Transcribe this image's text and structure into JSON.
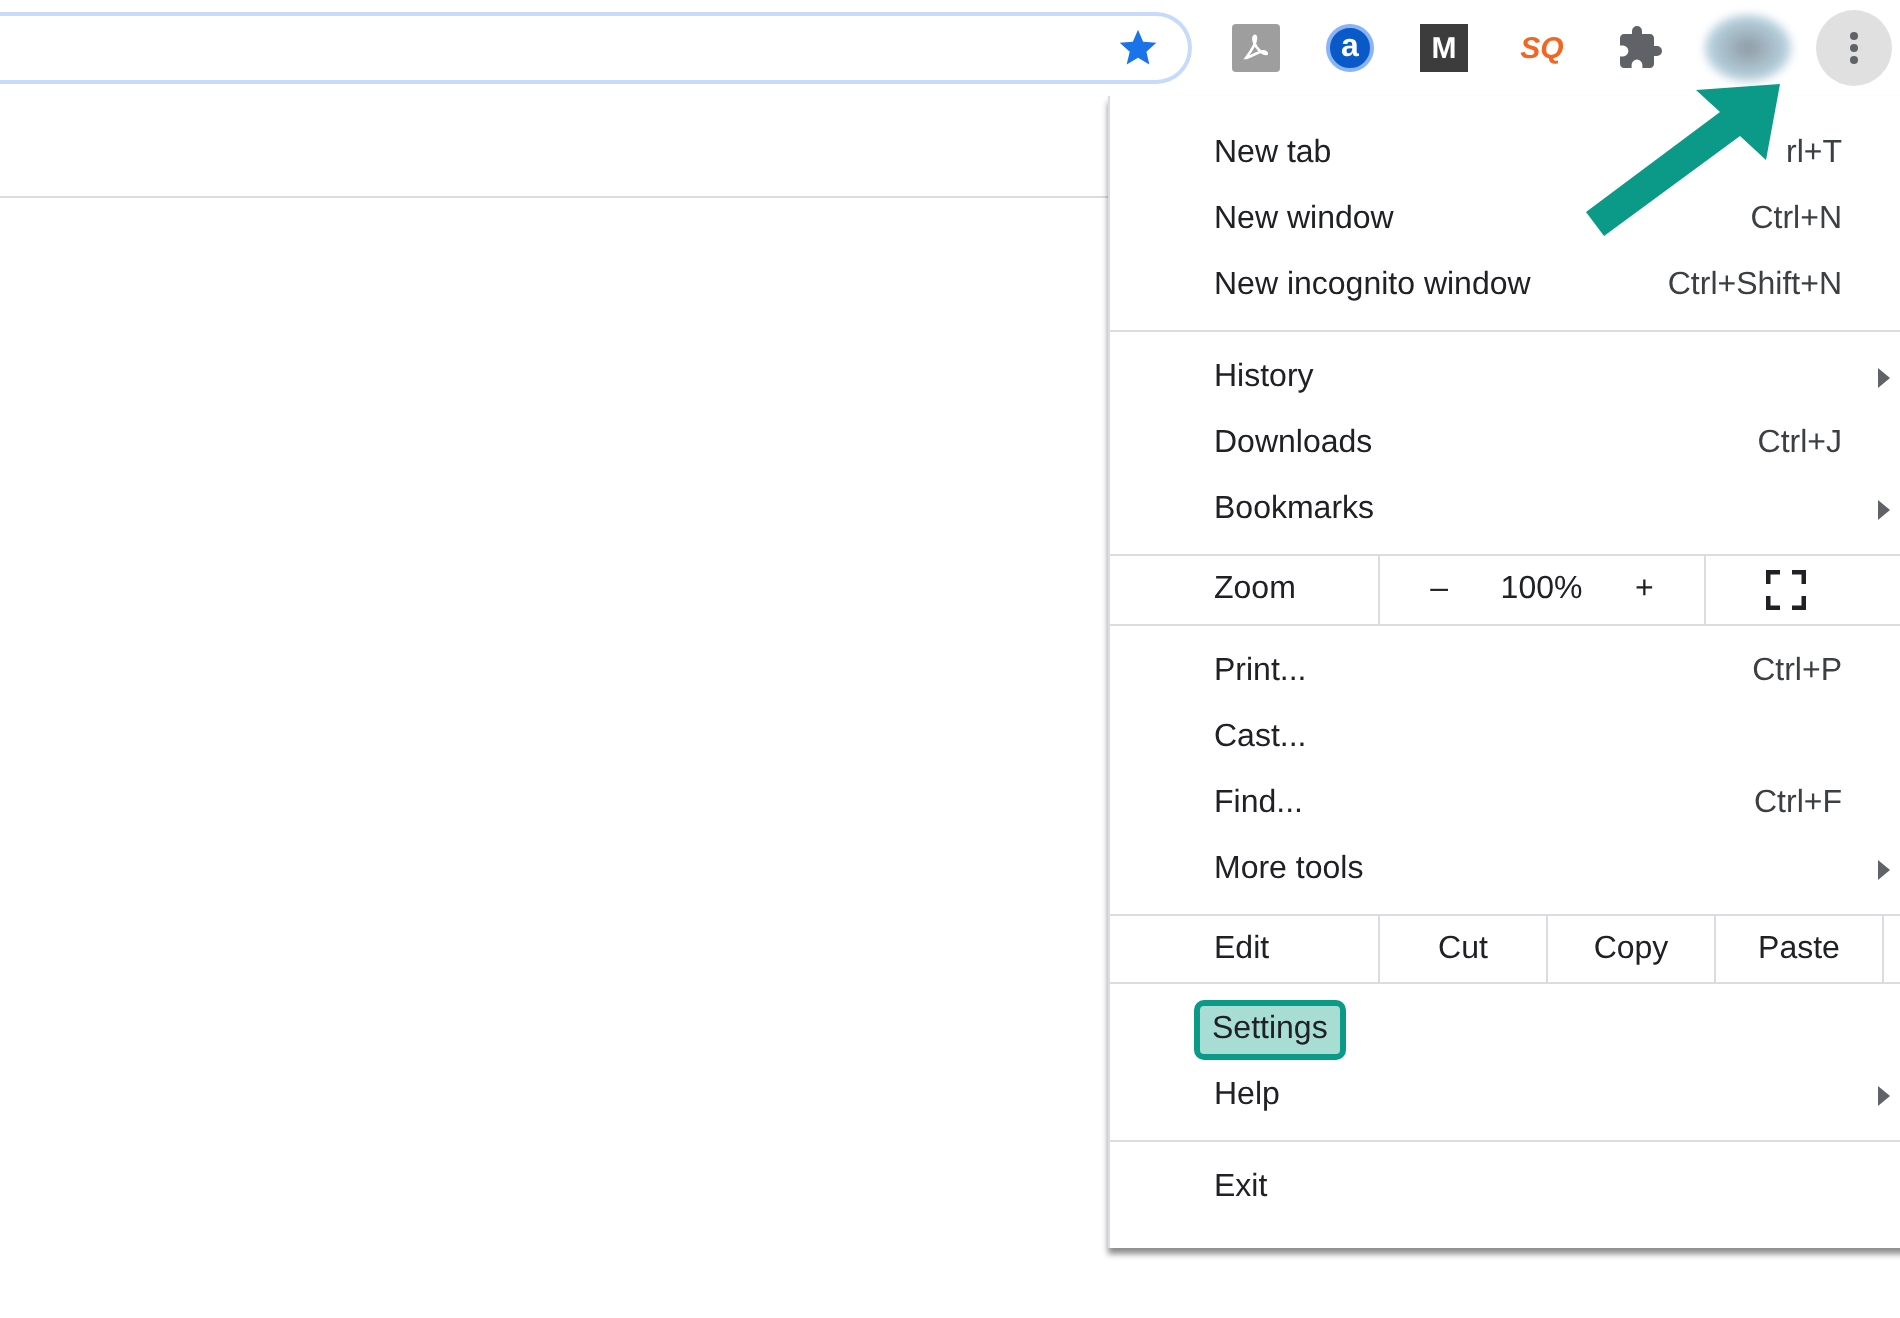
{
  "toolbar": {
    "extensions": [
      {
        "kind": "pdf"
      },
      {
        "kind": "circle",
        "glyph": "a"
      },
      {
        "kind": "square",
        "glyph": "M"
      },
      {
        "kind": "sq",
        "glyph": "SQ"
      },
      {
        "kind": "puzzle"
      }
    ]
  },
  "menu": {
    "sections": [
      [
        {
          "kind": "item",
          "label": "New tab",
          "shortcut": "rl+T",
          "has_submenu": false,
          "highlighted": false
        },
        {
          "kind": "item",
          "label": "New window",
          "shortcut": "Ctrl+N",
          "has_submenu": false,
          "highlighted": false
        },
        {
          "kind": "item",
          "label": "New incognito window",
          "shortcut": "Ctrl+Shift+N",
          "has_submenu": false,
          "highlighted": false
        }
      ],
      [
        {
          "kind": "item",
          "label": "History",
          "has_submenu": true,
          "highlighted": false
        },
        {
          "kind": "item",
          "label": "Downloads",
          "shortcut": "Ctrl+J",
          "has_submenu": false,
          "highlighted": false
        },
        {
          "kind": "item",
          "label": "Bookmarks",
          "has_submenu": true,
          "highlighted": false
        }
      ],
      [
        {
          "kind": "zoom",
          "label": "Zoom",
          "minus": "–",
          "value": "100%",
          "plus": "+"
        }
      ],
      [
        {
          "kind": "item",
          "label": "Print...",
          "shortcut": "Ctrl+P",
          "has_submenu": false,
          "highlighted": false
        },
        {
          "kind": "item",
          "label": "Cast...",
          "has_submenu": false,
          "highlighted": false
        },
        {
          "kind": "item",
          "label": "Find...",
          "shortcut": "Ctrl+F",
          "has_submenu": false,
          "highlighted": false
        },
        {
          "kind": "item",
          "label": "More tools",
          "has_submenu": true,
          "highlighted": false
        }
      ],
      [
        {
          "kind": "edit",
          "label": "Edit",
          "buttons": [
            "Cut",
            "Copy",
            "Paste"
          ]
        }
      ],
      [
        {
          "kind": "item",
          "label": "Settings",
          "has_submenu": false,
          "highlighted": true
        },
        {
          "kind": "item",
          "label": "Help",
          "has_submenu": true,
          "highlighted": false
        }
      ],
      [
        {
          "kind": "item",
          "label": "Exit",
          "has_submenu": false,
          "highlighted": false
        }
      ]
    ]
  }
}
